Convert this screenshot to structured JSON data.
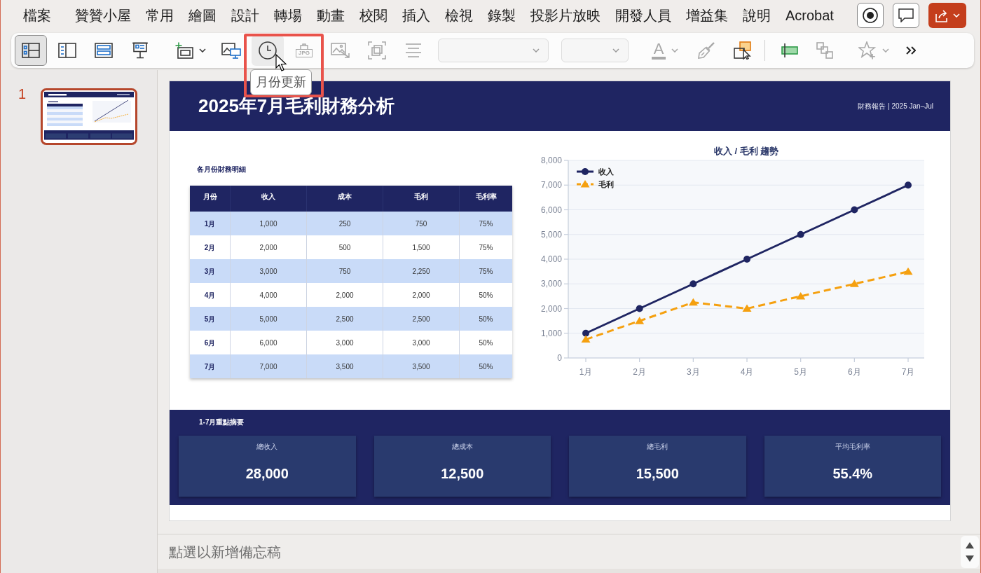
{
  "menu_bar": {
    "tabs": [
      "檔案",
      "贊贊小屋",
      "常用",
      "繪圖",
      "設計",
      "轉場",
      "動畫",
      "校閱",
      "插入",
      "檢視",
      "錄製",
      "投影片放映",
      "開發人員",
      "增益集",
      "說明",
      "Acrobat"
    ]
  },
  "toolbar": {
    "groups": [
      {
        "items": [
          {
            "kind": "button",
            "selected": true,
            "hovered": false,
            "disabled": false
          },
          {
            "kind": "button",
            "selected": false,
            "hovered": false,
            "disabled": false
          },
          {
            "kind": "button",
            "selected": false,
            "hovered": false,
            "disabled": false
          },
          {
            "kind": "button",
            "selected": false,
            "hovered": false,
            "disabled": false
          },
          {
            "kind": "split",
            "selected": false,
            "hovered": false,
            "disabled": false
          },
          {
            "kind": "button",
            "selected": false,
            "hovered": false,
            "disabled": false
          },
          {
            "kind": "button",
            "selected": false,
            "hovered": true,
            "disabled": false
          },
          {
            "kind": "button",
            "label": "JPG",
            "selected": false,
            "hovered": false,
            "disabled": true
          },
          {
            "kind": "button",
            "selected": false,
            "hovered": false,
            "disabled": true
          },
          {
            "kind": "button",
            "selected": false,
            "hovered": false,
            "disabled": true
          },
          {
            "kind": "button",
            "selected": false,
            "hovered": false,
            "disabled": true
          },
          {
            "kind": "dropdown",
            "selected": false,
            "hovered": false,
            "disabled": true
          },
          {
            "kind": "dropdown",
            "selected": false,
            "hovered": false,
            "disabled": true
          },
          {
            "kind": "split",
            "label": "A",
            "selected": false,
            "hovered": false,
            "disabled": true
          },
          {
            "kind": "button",
            "selected": false,
            "hovered": false,
            "disabled": true
          },
          {
            "kind": "button",
            "selected": false,
            "hovered": false,
            "disabled": false
          }
        ]
      },
      {
        "items": [
          {
            "kind": "button",
            "selected": false,
            "hovered": false,
            "disabled": false
          },
          {
            "kind": "button",
            "selected": false,
            "hovered": false,
            "disabled": true
          },
          {
            "kind": "split",
            "selected": false,
            "hovered": false,
            "disabled": true
          },
          {
            "kind": "overflow",
            "selected": false,
            "hovered": false,
            "disabled": false
          }
        ]
      }
    ],
    "tooltip": {
      "text": "月份更新"
    }
  },
  "slides_panel": {
    "slides": [
      {
        "number": "1",
        "selected": true
      }
    ]
  },
  "slide": {
    "header": {
      "title": "2025年7月毛利財務分析",
      "subtitle": "財務報告 | 2025 Jan–Jul"
    },
    "table": {
      "caption": "各月份財務明細",
      "columns": [
        "月份",
        "收入",
        "成本",
        "毛利",
        "毛利率"
      ],
      "rows": [
        [
          "1月",
          "1,000",
          "250",
          "750",
          "75%"
        ],
        [
          "2月",
          "2,000",
          "500",
          "1,500",
          "75%"
        ],
        [
          "3月",
          "3,000",
          "750",
          "2,250",
          "75%"
        ],
        [
          "4月",
          "4,000",
          "2,000",
          "2,000",
          "50%"
        ],
        [
          "5月",
          "5,000",
          "2,500",
          "2,500",
          "50%"
        ],
        [
          "6月",
          "6,000",
          "3,000",
          "3,000",
          "50%"
        ],
        [
          "7月",
          "7,000",
          "3,500",
          "3,500",
          "50%"
        ]
      ]
    },
    "chart": {
      "chart_data": {
        "type": "line",
        "title": "收入 / 毛利 趨勢",
        "categories": [
          "1月",
          "2月",
          "3月",
          "4月",
          "5月",
          "6月",
          "7月"
        ],
        "series": [
          {
            "name": "收入",
            "color": "#1f2562",
            "line_style": "solid",
            "marker": "circle",
            "values": [
              1000,
              2000,
              3000,
              4000,
              5000,
              6000,
              7000
            ]
          },
          {
            "name": "毛利",
            "color": "#f5a00f",
            "line_style": "dashed",
            "marker": "triangle",
            "values": [
              750,
              1500,
              2250,
              2000,
              2500,
              3000,
              3500
            ]
          }
        ],
        "ylim": [
          0,
          8000
        ],
        "yticks": [
          0,
          {
            "value": 1000,
            "label": "1,000"
          },
          {
            "value": 2000,
            "label": "2,000"
          },
          {
            "value": 3000,
            "label": "3,000"
          },
          {
            "value": 4000,
            "label": "4,000"
          },
          {
            "value": 5000,
            "label": "5,000"
          },
          {
            "value": 6000,
            "label": "6,000"
          },
          {
            "value": 7000,
            "label": "7,000"
          },
          {
            "value": 8000,
            "label": "8,000"
          }
        ],
        "grid": true,
        "legend": "upper left"
      }
    },
    "summary": {
      "title": "1-7月重點摘要",
      "cards": [
        {
          "label": "總收入",
          "value": "28,000"
        },
        {
          "label": "總成本",
          "value": "12,500"
        },
        {
          "label": "總毛利",
          "value": "15,500"
        },
        {
          "label": "平均毛利率",
          "value": "55.4%"
        }
      ]
    }
  },
  "notes": {
    "placeholder": "點選以新增備忘稿"
  }
}
